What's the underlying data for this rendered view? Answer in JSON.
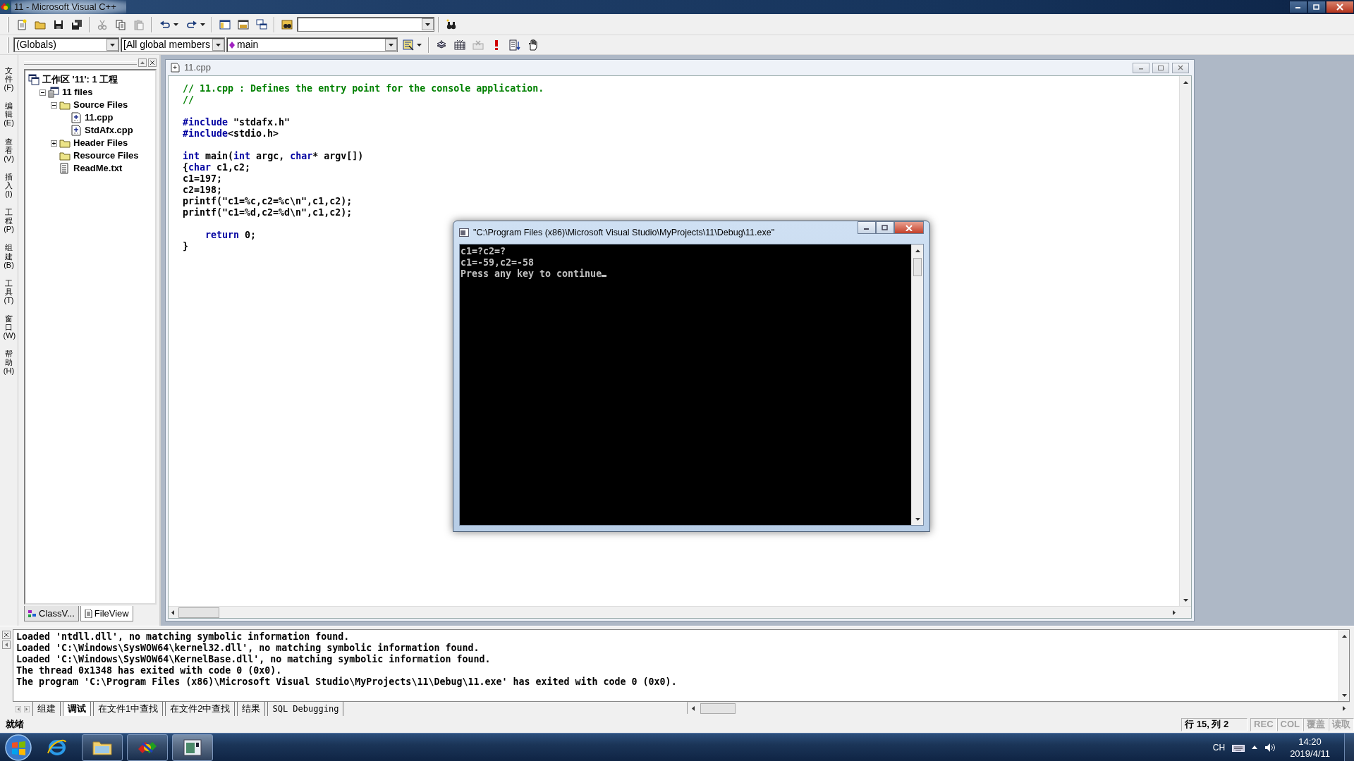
{
  "window": {
    "title": "11 - Microsoft Visual C++"
  },
  "toolbar_1": {
    "buttons": [
      {
        "kind": "new",
        "disabled": false
      },
      {
        "kind": "open",
        "disabled": false
      },
      {
        "kind": "save",
        "disabled": false
      },
      {
        "kind": "save_all",
        "disabled": false
      },
      {
        "kind": "sep"
      },
      {
        "kind": "cut",
        "disabled": true
      },
      {
        "kind": "copy",
        "disabled": false
      },
      {
        "kind": "paste",
        "disabled": true
      },
      {
        "kind": "sep"
      },
      {
        "kind": "undo",
        "disabled": false
      },
      {
        "kind": "redo",
        "disabled": false
      },
      {
        "kind": "sep"
      },
      {
        "kind": "workspace",
        "disabled": false
      },
      {
        "kind": "output",
        "disabled": false
      },
      {
        "kind": "windows",
        "disabled": false
      },
      {
        "kind": "sep"
      },
      {
        "kind": "find_in_files",
        "disabled": false
      },
      {
        "kind": "find_combo"
      },
      {
        "kind": "sep"
      },
      {
        "kind": "find",
        "disabled": false
      }
    ]
  },
  "toolbar_2": {
    "scope": "(Globals)",
    "members": "[All global members",
    "function": "main",
    "buttons": [
      {
        "kind": "wizard",
        "disabled": false
      },
      {
        "kind": "sep"
      },
      {
        "kind": "compile",
        "disabled": false
      },
      {
        "kind": "build",
        "disabled": false
      },
      {
        "kind": "stop",
        "disabled": true
      },
      {
        "kind": "execute",
        "disabled": false
      },
      {
        "kind": "go",
        "disabled": false
      },
      {
        "kind": "breakpoint",
        "disabled": false
      }
    ]
  },
  "menu": [
    "文件(F)",
    "编辑(E)",
    "查看(V)",
    "插入(I)",
    "工程(P)",
    "组建(B)",
    "工具(T)",
    "窗口(W)",
    "帮助(H)"
  ],
  "workspace": {
    "tree": [
      {
        "label": "工作区 '11': 1 工程",
        "kind": "workspace",
        "children": [
          {
            "label": "11 files",
            "kind": "project",
            "expanded": true,
            "children": [
              {
                "label": "Source Files",
                "kind": "folder",
                "expanded": true,
                "children": [
                  {
                    "label": "11.cpp",
                    "kind": "source"
                  },
                  {
                    "label": "StdAfx.cpp",
                    "kind": "source"
                  }
                ]
              },
              {
                "label": "Header Files",
                "kind": "folder",
                "expanded": false
              },
              {
                "label": "Resource Files",
                "kind": "folder"
              },
              {
                "label": "ReadMe.txt",
                "kind": "text"
              }
            ]
          }
        ]
      }
    ],
    "tabs": [
      {
        "label": "ClassV...",
        "kind": "class",
        "selected": false
      },
      {
        "label": "FileView",
        "kind": "file",
        "selected": true
      }
    ]
  },
  "editor": {
    "title": "11.cpp",
    "lines": [
      {
        "kind": "code",
        "segments": [
          {
            "text": "// 11.cpp : Defines the entry point for the console application.",
            "kind": "comment"
          }
        ]
      },
      {
        "kind": "code",
        "segments": [
          {
            "text": "//",
            "kind": "comment"
          }
        ]
      },
      {
        "kind": "blank"
      },
      {
        "kind": "code",
        "segments": [
          {
            "text": "#include",
            "kind": "keyword"
          },
          {
            "text": " \"stdafx.h\"",
            "kind": "plain"
          }
        ]
      },
      {
        "kind": "code",
        "segments": [
          {
            "text": "#include",
            "kind": "keyword"
          },
          {
            "text": "<stdio.h>",
            "kind": "plain"
          }
        ]
      },
      {
        "kind": "blank"
      },
      {
        "kind": "code",
        "segments": [
          {
            "text": "int",
            "kind": "keyword"
          },
          {
            "text": " main(",
            "kind": "plain"
          },
          {
            "text": "int",
            "kind": "keyword"
          },
          {
            "text": " argc, ",
            "kind": "plain"
          },
          {
            "text": "char",
            "kind": "keyword"
          },
          {
            "text": "* argv[])",
            "kind": "plain"
          }
        ]
      },
      {
        "kind": "code",
        "segments": [
          {
            "text": "{",
            "kind": "plain"
          },
          {
            "text": "char",
            "kind": "keyword"
          },
          {
            "text": " c1,c2;",
            "kind": "plain"
          }
        ]
      },
      {
        "kind": "code",
        "segments": [
          {
            "text": "c1=197;",
            "kind": "plain"
          }
        ]
      },
      {
        "kind": "code",
        "segments": [
          {
            "text": "c2=198;",
            "kind": "plain"
          }
        ]
      },
      {
        "kind": "code",
        "segments": [
          {
            "text": "printf(\"c1=%c,c2=%c\\n\",c1,c2);",
            "kind": "plain"
          }
        ]
      },
      {
        "kind": "code",
        "segments": [
          {
            "text": "printf(\"c1=%d,c2=%d\\n\",c1,c2);",
            "kind": "plain"
          }
        ]
      },
      {
        "kind": "blank"
      },
      {
        "kind": "code",
        "segments": [
          {
            "text": "    return",
            "kind": "keyword"
          },
          {
            "text": " 0;",
            "kind": "plain"
          }
        ]
      },
      {
        "kind": "code",
        "segments": [
          {
            "text": "}",
            "kind": "plain"
          }
        ]
      }
    ]
  },
  "console": {
    "title": "\"C:\\Program Files (x86)\\Microsoft Visual Studio\\MyProjects\\11\\Debug\\11.exe\"",
    "lines": [
      "c1=?c2=?",
      "c1=-59,c2=-58",
      "Press any key to continue"
    ]
  },
  "output": {
    "lines": [
      "Loaded 'ntdll.dll', no matching symbolic information found.",
      "Loaded 'C:\\Windows\\SysWOW64\\kernel32.dll', no matching symbolic information found.",
      "Loaded 'C:\\Windows\\SysWOW64\\KernelBase.dll', no matching symbolic information found.",
      "The thread 0x1348 has exited with code 0 (0x0).",
      "The program 'C:\\Program Files (x86)\\Microsoft Visual Studio\\MyProjects\\11\\Debug\\11.exe' has exited with code 0 (0x0)."
    ],
    "tabs": [
      {
        "label": "组建",
        "selected": false
      },
      {
        "label": "调试",
        "selected": true
      },
      {
        "label": "在文件1中查找",
        "selected": false
      },
      {
        "label": "在文件2中查找",
        "selected": false
      },
      {
        "label": "结果",
        "selected": false
      },
      {
        "label": "SQL Debugging",
        "selected": false
      }
    ]
  },
  "status_bar": {
    "message": "就绪",
    "position": "行 15, 列 2",
    "indicators": [
      {
        "label": "REC",
        "on": false
      },
      {
        "label": "COL",
        "on": false
      },
      {
        "label": "覆盖",
        "on": false
      },
      {
        "label": "读取",
        "on": false
      }
    ]
  },
  "taskbar": {
    "apps": [
      {
        "kind": "browser",
        "running": false,
        "selected": false
      },
      {
        "kind": "explorer",
        "running": true,
        "selected": false
      },
      {
        "kind": "vc",
        "running": true,
        "selected": false
      },
      {
        "kind": "console",
        "running": true,
        "selected": true
      }
    ],
    "language": "CH",
    "time": "14:20",
    "date": "2019/4/11"
  }
}
